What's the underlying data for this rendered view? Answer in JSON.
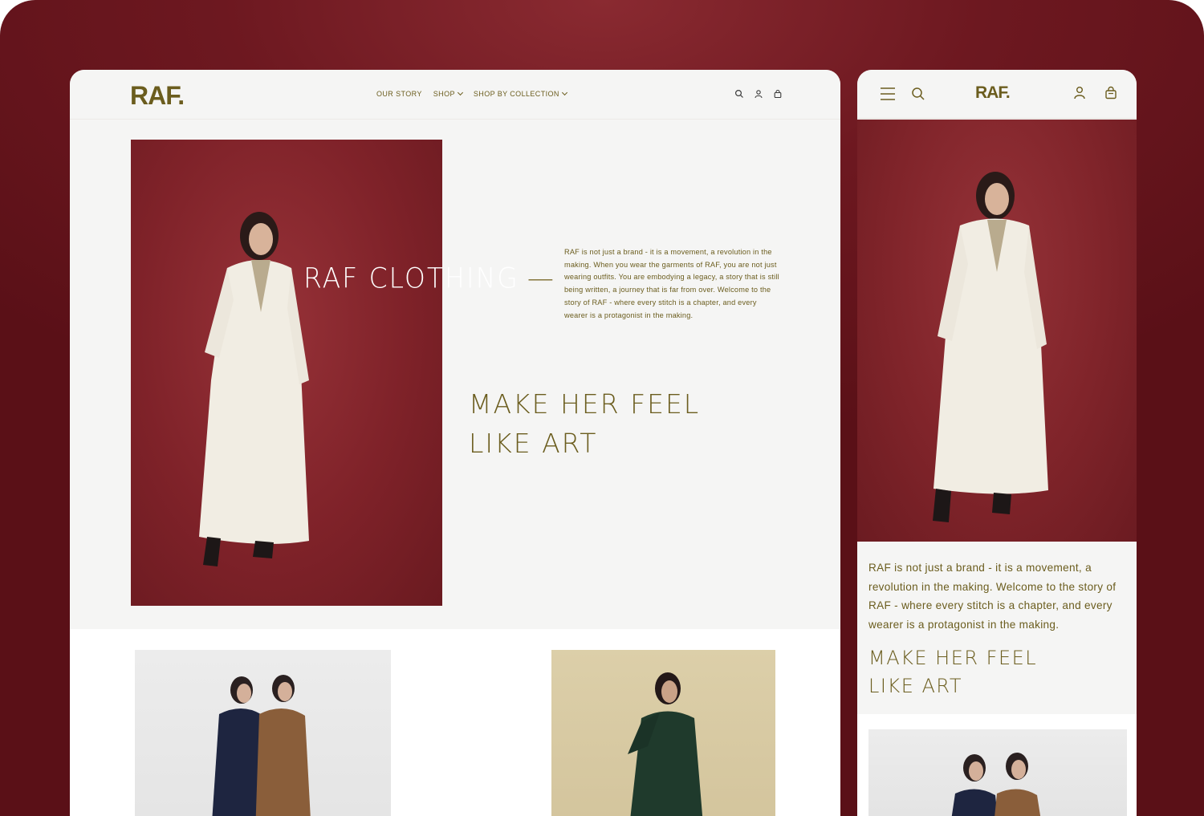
{
  "colors": {
    "brand": "#6b5d1e",
    "background": "#5a1017",
    "hero_red": "#7f2229",
    "page": "#f5f5f4"
  },
  "desktop": {
    "logo": "RAF.",
    "nav": [
      {
        "label": "OUR STORY",
        "has_dropdown": false
      },
      {
        "label": "SHOP",
        "has_dropdown": true
      },
      {
        "label": "SHOP BY COLLECTION",
        "has_dropdown": true
      }
    ],
    "icons": [
      "search-icon",
      "account-icon",
      "cart-icon"
    ],
    "hero": {
      "title": "RAF CLOTHING",
      "title_dash": "—",
      "copy": "RAF is not just a brand - it is a movement, a revolution in the making. When you wear the garments of RAF, you are not just wearing outfits. You are embodying a legacy, a story that is still being written, a journey that is far from over. Welcome to the story of RAF - where every stitch is a chapter, and every wearer is a protagonist in the making.",
      "tagline_line1": "MAKE HER FEEL",
      "tagline_line2": "LIKE ART"
    }
  },
  "mobile": {
    "logo": "RAF.",
    "icons": [
      "menu-icon",
      "search-icon",
      "account-icon",
      "cart-icon"
    ],
    "copy": "RAF is not just a brand - it is a movement, a revolution in the making. Welcome to the story of RAF - where every stitch is a chapter, and every wearer is a protagonist in the making.",
    "tagline_line1": "MAKE HER FEEL",
    "tagline_line2": "LIKE ART"
  }
}
